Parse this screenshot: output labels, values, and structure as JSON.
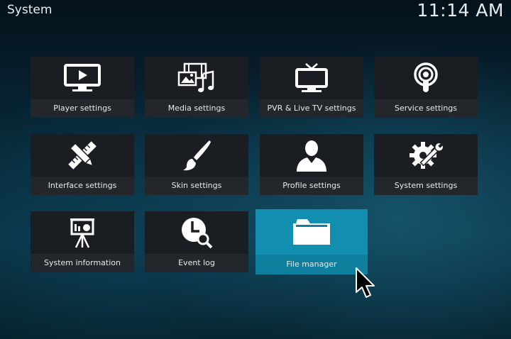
{
  "header": {
    "title": "System",
    "clock": "11:14 AM"
  },
  "tiles": [
    {
      "label": "Player settings",
      "icon": "monitor-play-icon"
    },
    {
      "label": "Media settings",
      "icon": "media-icon"
    },
    {
      "label": "PVR & Live TV settings",
      "icon": "tv-icon"
    },
    {
      "label": "Service settings",
      "icon": "podcast-icon"
    },
    {
      "label": "Interface settings",
      "icon": "pencil-ruler-icon"
    },
    {
      "label": "Skin settings",
      "icon": "paintbrush-icon"
    },
    {
      "label": "Profile settings",
      "icon": "user-icon"
    },
    {
      "label": "System settings",
      "icon": "gear-wrench-icon"
    },
    {
      "label": "System information",
      "icon": "presentation-icon"
    },
    {
      "label": "Event log",
      "icon": "clock-search-icon"
    },
    {
      "label": "File manager",
      "icon": "folder-icon"
    }
  ],
  "colors": {
    "focus": "#128fb0",
    "tile": "#1a1d21"
  }
}
